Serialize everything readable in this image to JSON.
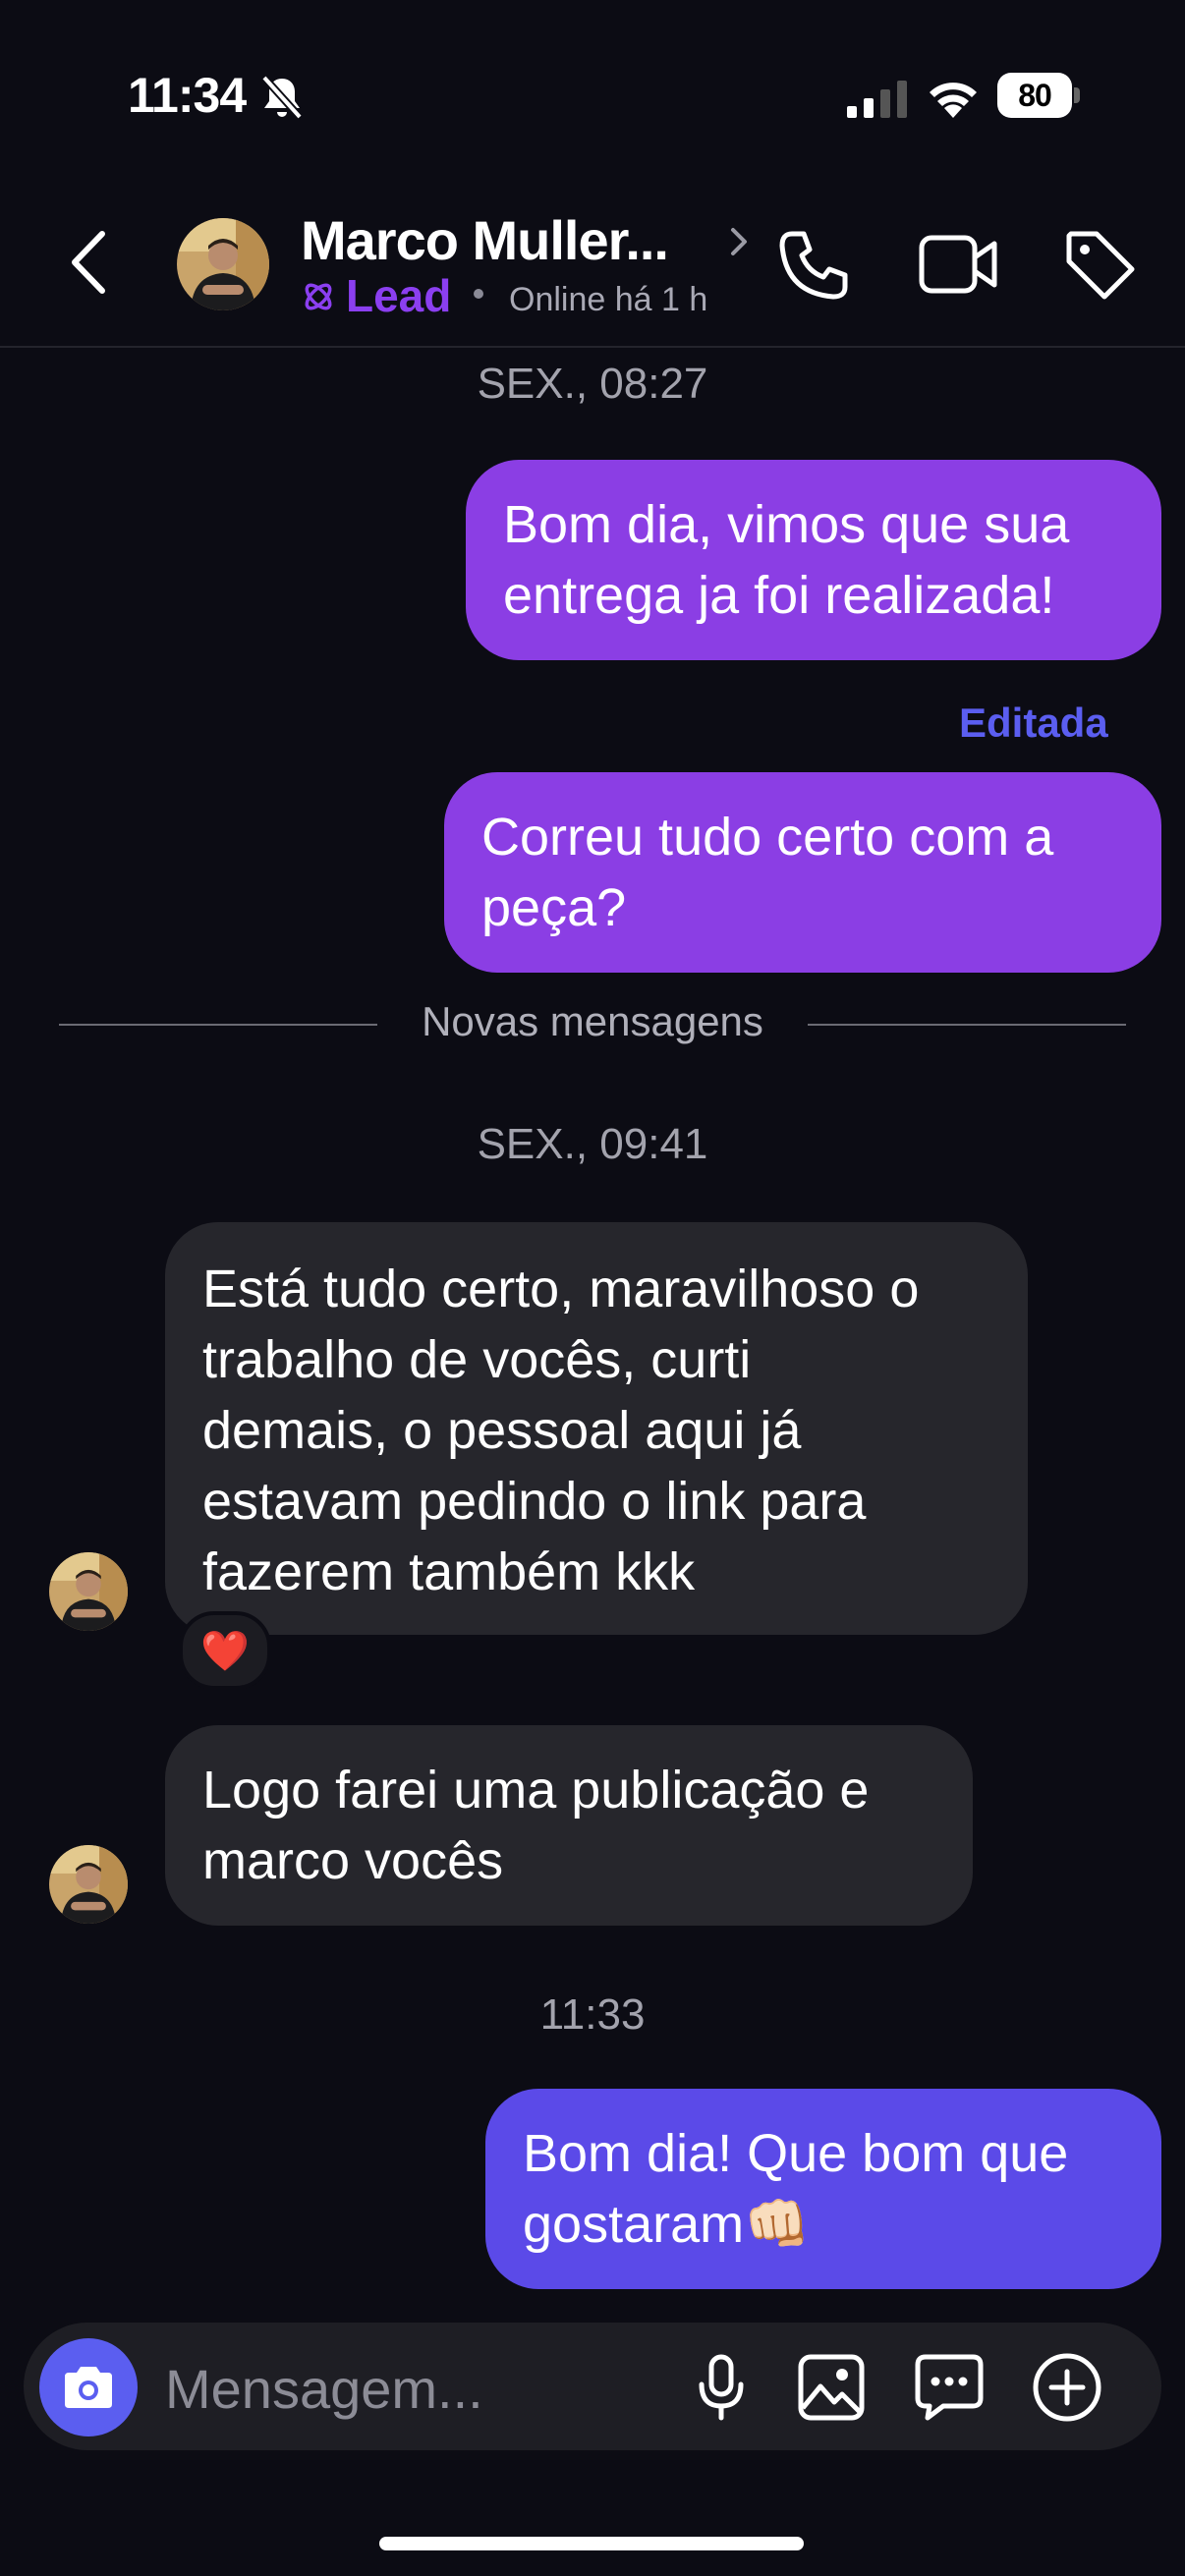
{
  "status_bar": {
    "time": "11:34",
    "battery": "80"
  },
  "header": {
    "name": "Marco Muller...",
    "lead_label": "Lead",
    "online_status": "Online há 1 h"
  },
  "messages": {
    "time_1": "SEX., 08:27",
    "out_1": "Bom dia, vimos que sua\nentrega ja foi realizada!",
    "edited_label": "Editada",
    "out_2": "Correu tudo certo com a\npeça?",
    "new_messages": "Novas mensagens",
    "time_2": "SEX., 09:41",
    "in_1": "Está tudo certo, maravilhoso o\ntrabalho de vocês, curti\ndemais, o pessoal aqui já\nestavam pedindo o link para\nfazerem também kkk",
    "reaction": "❤️",
    "in_2": "Logo farei uma publicação e\nmarco vocês",
    "time_3": "11:33",
    "out_3": "Bom dia! Que bom que\ngostaram👊🏻"
  },
  "composer": {
    "placeholder": "Mensagem..."
  },
  "colors": {
    "background": "#0c0c14",
    "outgoing_bubble": "#8b3ee4",
    "outgoing_bubble_recent": "#5b4ae8",
    "incoming_bubble": "#26262c",
    "accent": "#5b5ef0",
    "lead": "#8b3ff0"
  },
  "icons": [
    "bell-off-icon",
    "signal-icon",
    "wifi-icon",
    "back-icon",
    "chevron-right-icon",
    "lead-icon",
    "phone-icon",
    "video-icon",
    "tag-icon",
    "camera-icon",
    "microphone-icon",
    "image-icon",
    "chat-icon",
    "plus-icon"
  ]
}
